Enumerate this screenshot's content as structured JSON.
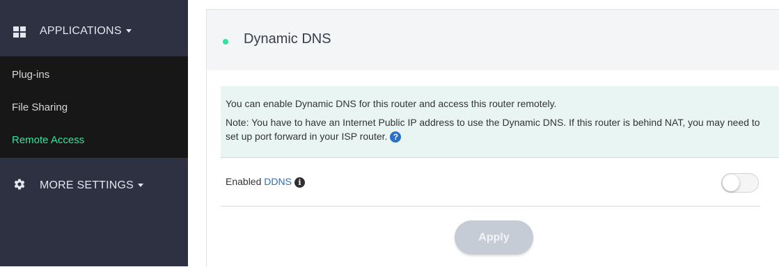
{
  "sidebar": {
    "applications_label": "APPLICATIONS",
    "applications_icon": "grid-icon",
    "items": [
      {
        "label": "Plug-ins",
        "active": false
      },
      {
        "label": "File Sharing",
        "active": false
      },
      {
        "label": "Remote Access",
        "active": true
      }
    ],
    "more_settings_label": "MORE SETTINGS",
    "more_settings_icon": "gear-icon"
  },
  "panel": {
    "title": "Dynamic DNS",
    "status_color": "#2ee59d",
    "info_line1": "You can enable Dynamic DNS for this router and access this router remotely.",
    "info_line2": "Note: You have to have an Internet Public IP address to use the Dynamic DNS. If this router is behind NAT, you may need to set up port forward in your ISP router.",
    "help_icon_glyph": "?",
    "ddns_prefix": "Enabled ",
    "ddns_link": "DDNS",
    "info_icon_glyph": "i",
    "ddns_enabled": false,
    "apply_label": "Apply"
  },
  "colors": {
    "sidebar_bg": "#2d3142",
    "submenu_bg": "#171717",
    "accent": "#2ee59d",
    "link": "#2a6fc9",
    "apply_disabled": "#c5ccd6"
  }
}
